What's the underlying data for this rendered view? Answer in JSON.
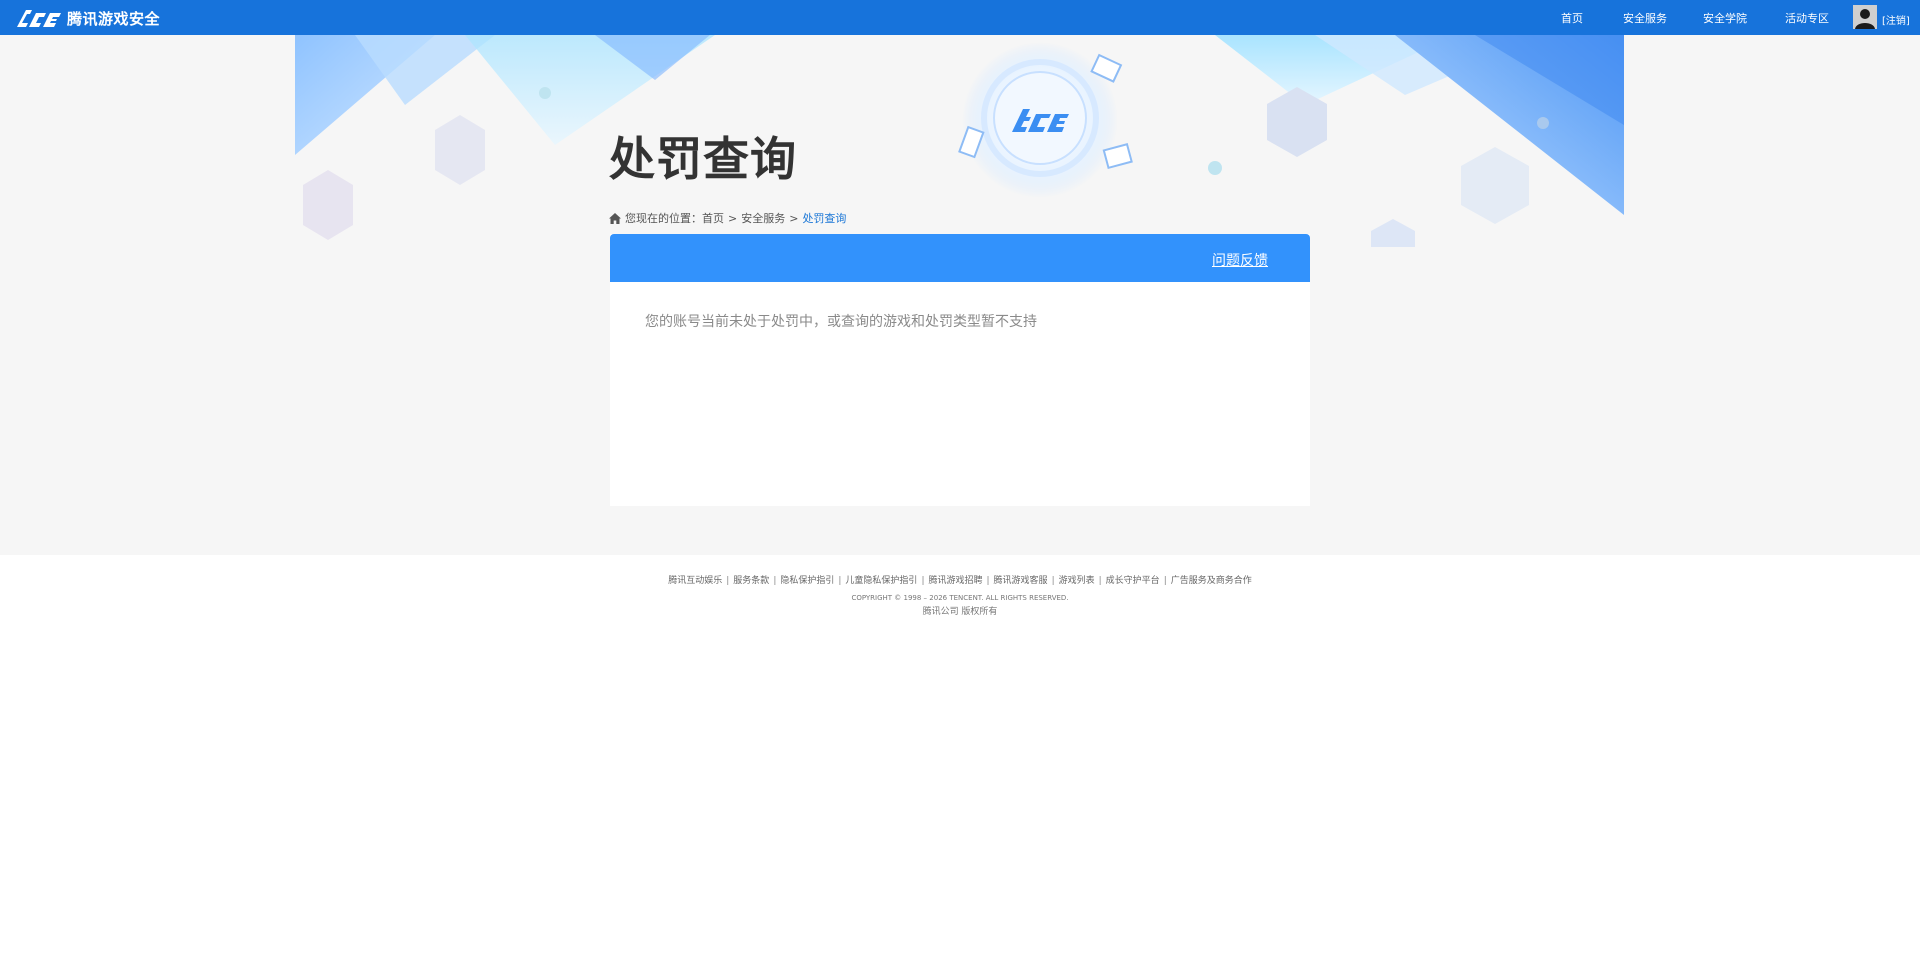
{
  "header": {
    "logo_text": "腾讯游戏安全",
    "nav": [
      {
        "label": "首页"
      },
      {
        "label": "安全服务"
      },
      {
        "label": "安全学院"
      },
      {
        "label": "活动专区"
      }
    ],
    "logout_label": "[注销]"
  },
  "main": {
    "title": "处罚查询",
    "breadcrumb": {
      "prefix": "您现在的位置：",
      "items": [
        "首页",
        "安全服务",
        "处罚查询"
      ],
      "separator": ">"
    },
    "panel": {
      "feedback_label": "问题反馈",
      "message": "您的账号当前未处于处罚中，或查询的游戏和处罚类型暂不支持"
    }
  },
  "footer": {
    "links": [
      "腾讯互动娱乐",
      "服务条款",
      "隐私保护指引",
      "儿童隐私保护指引",
      "腾讯游戏招聘",
      "腾讯游戏客服",
      "游戏列表",
      "成长守护平台",
      "广告服务及商务合作"
    ],
    "copyright": "COPYRIGHT © 1998 – 2026 TENCENT. ALL RIGHTS RESERVED.",
    "rights": "腾讯公司 版权所有"
  },
  "colors": {
    "topbar": "#1773db",
    "panel_header": "#3292fc",
    "breadcrumb_current": "#1a76d6",
    "page_background": "#f6f6f6"
  }
}
